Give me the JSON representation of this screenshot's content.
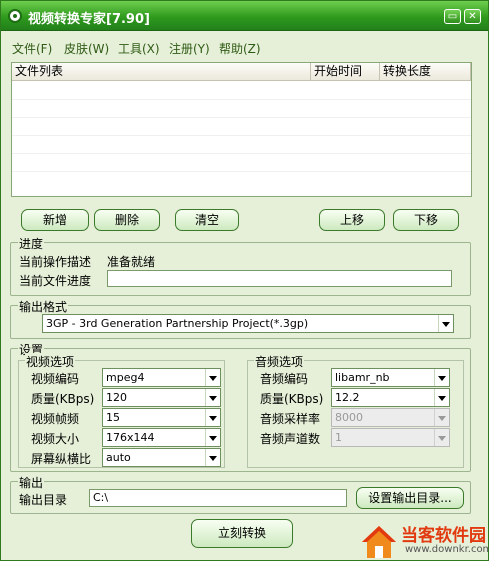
{
  "window": {
    "title": "视频转换专家[7.90]",
    "min_glyph": "▭",
    "close_glyph": "✕"
  },
  "menu": [
    "文件(F)",
    "皮肤(W)",
    "工具(X)",
    "注册(Y)",
    "帮助(Z)"
  ],
  "file_list": {
    "columns": [
      "文件列表",
      "开始时间",
      "转换长度"
    ]
  },
  "buttons": {
    "add": "新增",
    "delete": "删除",
    "clear": "清空",
    "move_up": "上移",
    "move_down": "下移"
  },
  "progress": {
    "group_label": "进度",
    "operation_label": "当前操作描述",
    "operation_value": "准备就绪",
    "file_progress_label": "当前文件进度"
  },
  "output_format": {
    "group_label": "输出格式",
    "value": "3GP - 3rd Generation Partnership Project(*.3gp)"
  },
  "settings": {
    "group_label": "设置",
    "video": {
      "group_label": "视频选项",
      "codec_label": "视频编码",
      "codec_value": "mpeg4",
      "quality_label": "质量(KBps)",
      "quality_value": "120",
      "fps_label": "视频帧频",
      "fps_value": "15",
      "size_label": "视频大小",
      "size_value": "176x144",
      "aspect_label": "屏幕纵横比",
      "aspect_value": "auto"
    },
    "audio": {
      "group_label": "音频选项",
      "codec_label": "音频编码",
      "codec_value": "libamr_nb",
      "quality_label": "质量(KBps)",
      "quality_value": "12.2",
      "samplerate_label": "音频采样率",
      "samplerate_value": "8000",
      "channels_label": "音频声道数",
      "channels_value": "1"
    }
  },
  "output": {
    "group_label": "输出",
    "dir_label": "输出目录",
    "dir_value": "C:\\",
    "set_dir_button": "设置输出目录..."
  },
  "convert_button": "立刻转换",
  "watermark": {
    "name": "当客软件园",
    "url": "www.downkr.com"
  }
}
